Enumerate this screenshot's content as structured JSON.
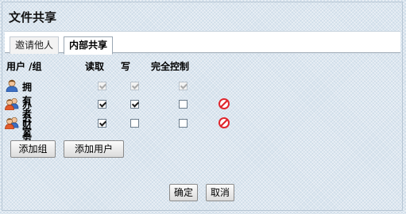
{
  "dialog": {
    "title": "文件共享"
  },
  "tabs": [
    {
      "label": "邀请他人",
      "active": false
    },
    {
      "label": "内部共享",
      "active": true
    }
  ],
  "table": {
    "headers": {
      "user_group": "用户 /组",
      "read": "读取",
      "write": "写",
      "full_control": "完全控制"
    },
    "rows": [
      {
        "name": "拥有者",
        "icon": "single-user-icon",
        "read": true,
        "write": true,
        "full": true,
        "editable": false,
        "removable": false
      },
      {
        "name": "办公室",
        "icon": "group-icon",
        "read": true,
        "write": true,
        "full": false,
        "editable": true,
        "removable": true
      },
      {
        "name": "财务部",
        "icon": "group-icon",
        "read": true,
        "write": false,
        "full": false,
        "editable": true,
        "removable": true
      }
    ]
  },
  "buttons": {
    "add_group": "添加组",
    "add_user": "添加用户",
    "ok": "确定",
    "cancel": "取消"
  },
  "colors": {
    "remove_icon": "#e0262d",
    "background": "#cfdde9"
  }
}
